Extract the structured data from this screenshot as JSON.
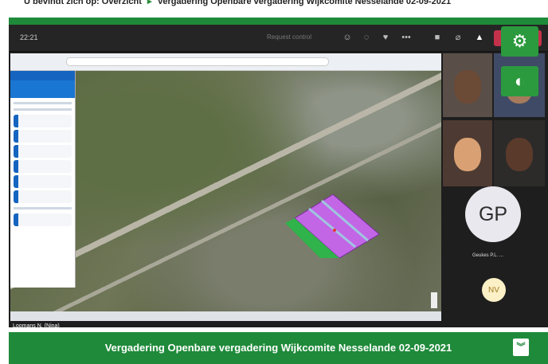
{
  "breadcrumb": {
    "prefix": "U bevindt zich op:",
    "home": "Overzicht",
    "separator": "▸",
    "current": "Vergadering Openbare vergadering Wijkcomite Nesselande 02-09-2021"
  },
  "meeting": {
    "time": "22:21",
    "request_control": "Request control",
    "presenter_name": "Loomans N. (Nina)"
  },
  "participants": {
    "gp": {
      "initials": "GP",
      "name": "Geukes P.L. ..."
    },
    "nv": {
      "initials": "NV"
    }
  },
  "icons": {
    "settings": "gear-icon",
    "contrast": "contrast-icon",
    "expand": "double-chevron-down-icon"
  },
  "title_bar": {
    "title": "Vergadering Openbare vergadering Wijkcomite Nesselande 02-09-2021",
    "expand_icon": "︾"
  },
  "colors": {
    "brand_green": "#1f8a3a",
    "teams_bg": "#1e1e1e",
    "leave_red": "#c4314b",
    "parcel_purple": "#c266e6",
    "parcel_green": "#2fb34a"
  }
}
